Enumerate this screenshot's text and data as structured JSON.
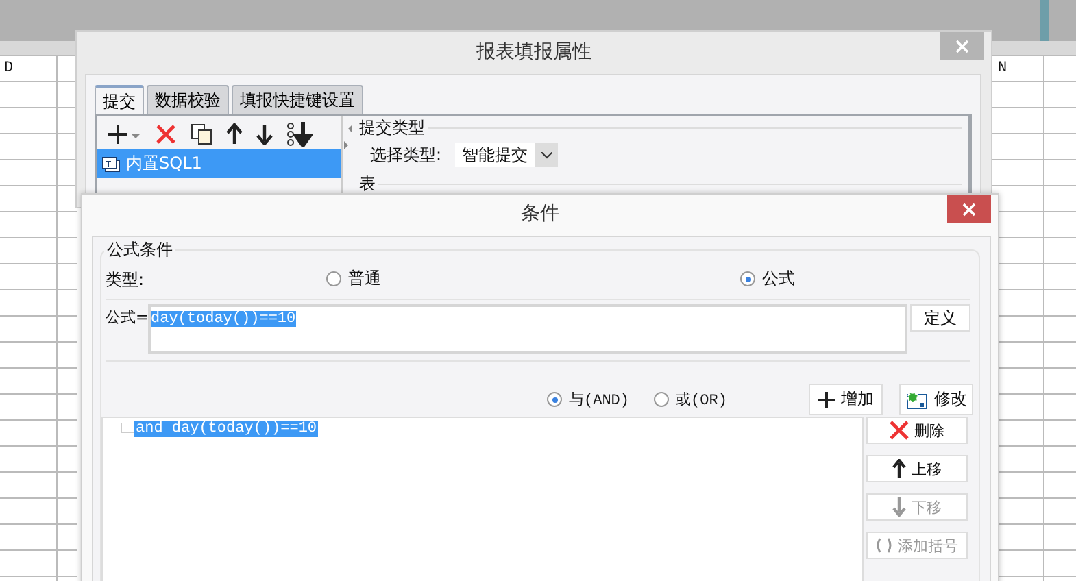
{
  "sheet": {
    "column_headers": [
      "D",
      "N"
    ]
  },
  "properties_dialog": {
    "title": "报表填报属性",
    "tabs": [
      {
        "label": "提交",
        "selected": true
      },
      {
        "label": "数据校验",
        "selected": false
      },
      {
        "label": "填报快捷键设置",
        "selected": false
      }
    ],
    "list_items": [
      {
        "label": "内置SQL1",
        "selected": true
      }
    ],
    "submit_type_group": "提交类型",
    "select_type_label": "选择类型:",
    "select_type_value": "智能提交",
    "table_group": "表"
  },
  "condition_dialog": {
    "title": "条件",
    "group_title": "公式条件",
    "type_label": "类型:",
    "type_options": [
      {
        "label": "普通",
        "selected": false
      },
      {
        "label": "公式",
        "selected": true
      }
    ],
    "formula_label": "公式=",
    "formula_value": "day(today())==10",
    "define_button": "定义",
    "join_options": [
      {
        "label": "与(AND)",
        "selected": true
      },
      {
        "label": "或(OR)",
        "selected": false
      }
    ],
    "add_button": "增加",
    "modify_button": "修改",
    "conditions": [
      {
        "text": "and day(today())==10",
        "selected": true
      }
    ],
    "side_buttons": [
      {
        "kind": "delete",
        "label": "删除",
        "disabled": false
      },
      {
        "kind": "up",
        "label": "上移",
        "disabled": false
      },
      {
        "kind": "down",
        "label": "下移",
        "disabled": true
      },
      {
        "kind": "bracket",
        "label": "添加括号",
        "disabled": true
      }
    ]
  }
}
